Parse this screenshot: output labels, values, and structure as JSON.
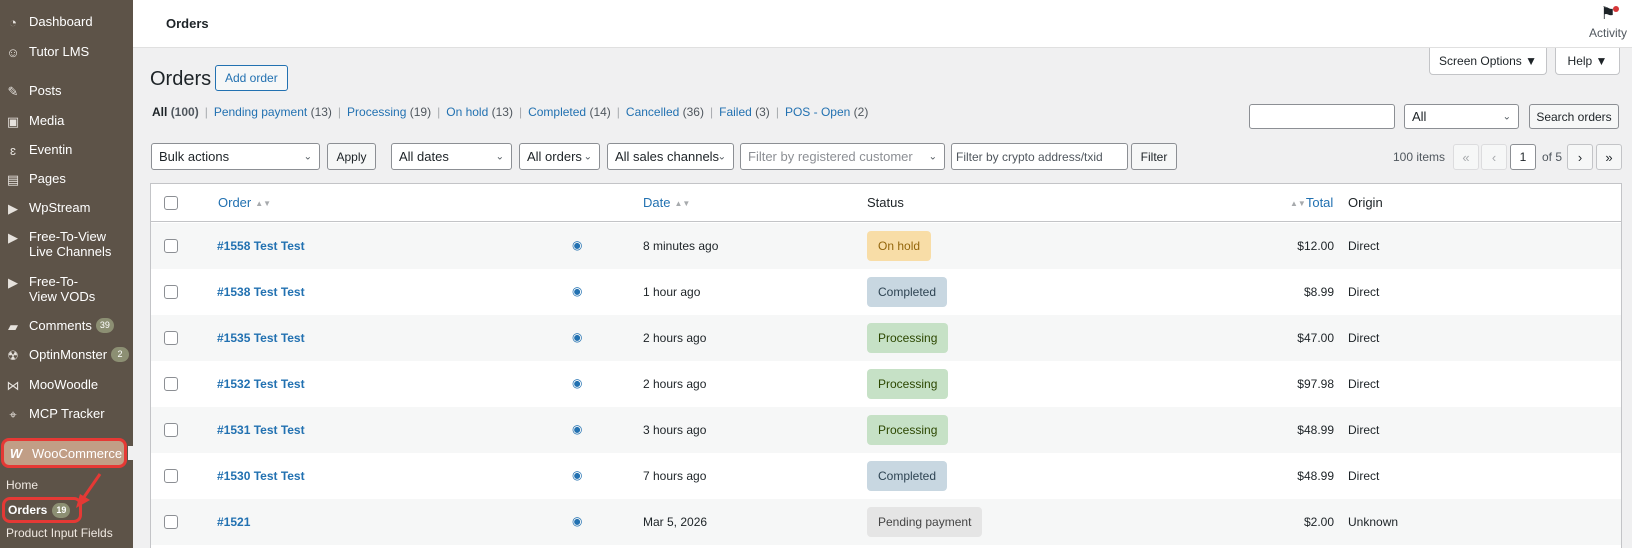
{
  "sidebar": {
    "items": [
      {
        "label": "Dashboard",
        "icon": "dashboard-icon"
      },
      {
        "label": "Tutor LMS",
        "icon": "tutor-icon"
      },
      {
        "label": "Posts",
        "icon": "pin-icon"
      },
      {
        "label": "Media",
        "icon": "media-icon"
      },
      {
        "label": "Eventin",
        "icon": "eventin-icon"
      },
      {
        "label": "Pages",
        "icon": "pages-icon"
      },
      {
        "label": "WpStream",
        "icon": "stream-icon"
      },
      {
        "label": "Free-To-View\nLive Channels",
        "icon": "stream-icon"
      },
      {
        "label": "Free-To-\nView VODs",
        "icon": "stream-icon"
      },
      {
        "label": "Comments",
        "icon": "comment-icon",
        "badge": "39"
      },
      {
        "label": "OptinMonster",
        "icon": "optinmonster-icon",
        "badge": "2"
      },
      {
        "label": "MooWoodle",
        "icon": "moowoodle-icon"
      },
      {
        "label": "MCP Tracker",
        "icon": "tracker-icon"
      }
    ],
    "woocommerce": {
      "label": "WooCommerce",
      "icon_glyph": "W"
    },
    "submenu": {
      "home": "Home",
      "orders": "Orders",
      "orders_badge": "19",
      "product_input_fields": "Product Input Fields"
    }
  },
  "topbar": {
    "title": "Orders",
    "activity_label": "Activity"
  },
  "screen_options": {
    "label": "Screen Options ▼",
    "help": "Help ▼"
  },
  "heading": {
    "title": "Orders",
    "add_order": "Add order"
  },
  "status_filters": [
    {
      "label": "All",
      "count": "(100)",
      "current": true
    },
    {
      "label": "Pending payment",
      "count": "(13)"
    },
    {
      "label": "Processing",
      "count": "(19)"
    },
    {
      "label": "On hold",
      "count": "(13)"
    },
    {
      "label": "Completed",
      "count": "(14)"
    },
    {
      "label": "Cancelled",
      "count": "(36)"
    },
    {
      "label": "Failed",
      "count": "(3)"
    },
    {
      "label": "POS - Open",
      "count": "(2)"
    }
  ],
  "search": {
    "placeholder": "",
    "type_value": "All",
    "button": "Search orders"
  },
  "filters": {
    "bulk_actions": "Bulk actions",
    "apply": "Apply",
    "dates": "All dates",
    "orders": "All orders",
    "sales_channels": "All sales channels",
    "customer_placeholder": "Filter by registered customer",
    "crypto_placeholder": "Filter by crypto address/txid",
    "filter_button": "Filter"
  },
  "pagination": {
    "items": "100 items",
    "first": "«",
    "prev": "‹",
    "current": "1",
    "of": "of 5",
    "next": "›",
    "last": "»"
  },
  "table": {
    "headers": {
      "order": "Order",
      "date": "Date",
      "status": "Status",
      "total": "Total",
      "origin": "Origin"
    },
    "rows": [
      {
        "order": "#1558 Test Test",
        "date": "8 minutes ago",
        "status": "On hold",
        "status_key": "on-hold",
        "total": "$12.00",
        "origin": "Direct"
      },
      {
        "order": "#1538 Test Test",
        "date": "1 hour ago",
        "status": "Completed",
        "status_key": "completed",
        "total": "$8.99",
        "origin": "Direct"
      },
      {
        "order": "#1535 Test Test",
        "date": "2 hours ago",
        "status": "Processing",
        "status_key": "processing",
        "total": "$47.00",
        "origin": "Direct"
      },
      {
        "order": "#1532 Test Test",
        "date": "2 hours ago",
        "status": "Processing",
        "status_key": "processing",
        "total": "$97.98",
        "origin": "Direct"
      },
      {
        "order": "#1531 Test Test",
        "date": "3 hours ago",
        "status": "Processing",
        "status_key": "processing",
        "total": "$48.99",
        "origin": "Direct"
      },
      {
        "order": "#1530 Test Test",
        "date": "7 hours ago",
        "status": "Completed",
        "status_key": "completed",
        "total": "$48.99",
        "origin": "Direct"
      },
      {
        "order": "#1521",
        "date": "Mar 5, 2026",
        "status": "Pending payment",
        "status_key": "pending",
        "total": "$2.00",
        "origin": "Unknown"
      }
    ]
  },
  "colors": {
    "sidebar_bg": "#5d5348",
    "woo_active_bg": "#c19e86",
    "highlight_red": "#e53935",
    "link_blue": "#2271b1"
  }
}
